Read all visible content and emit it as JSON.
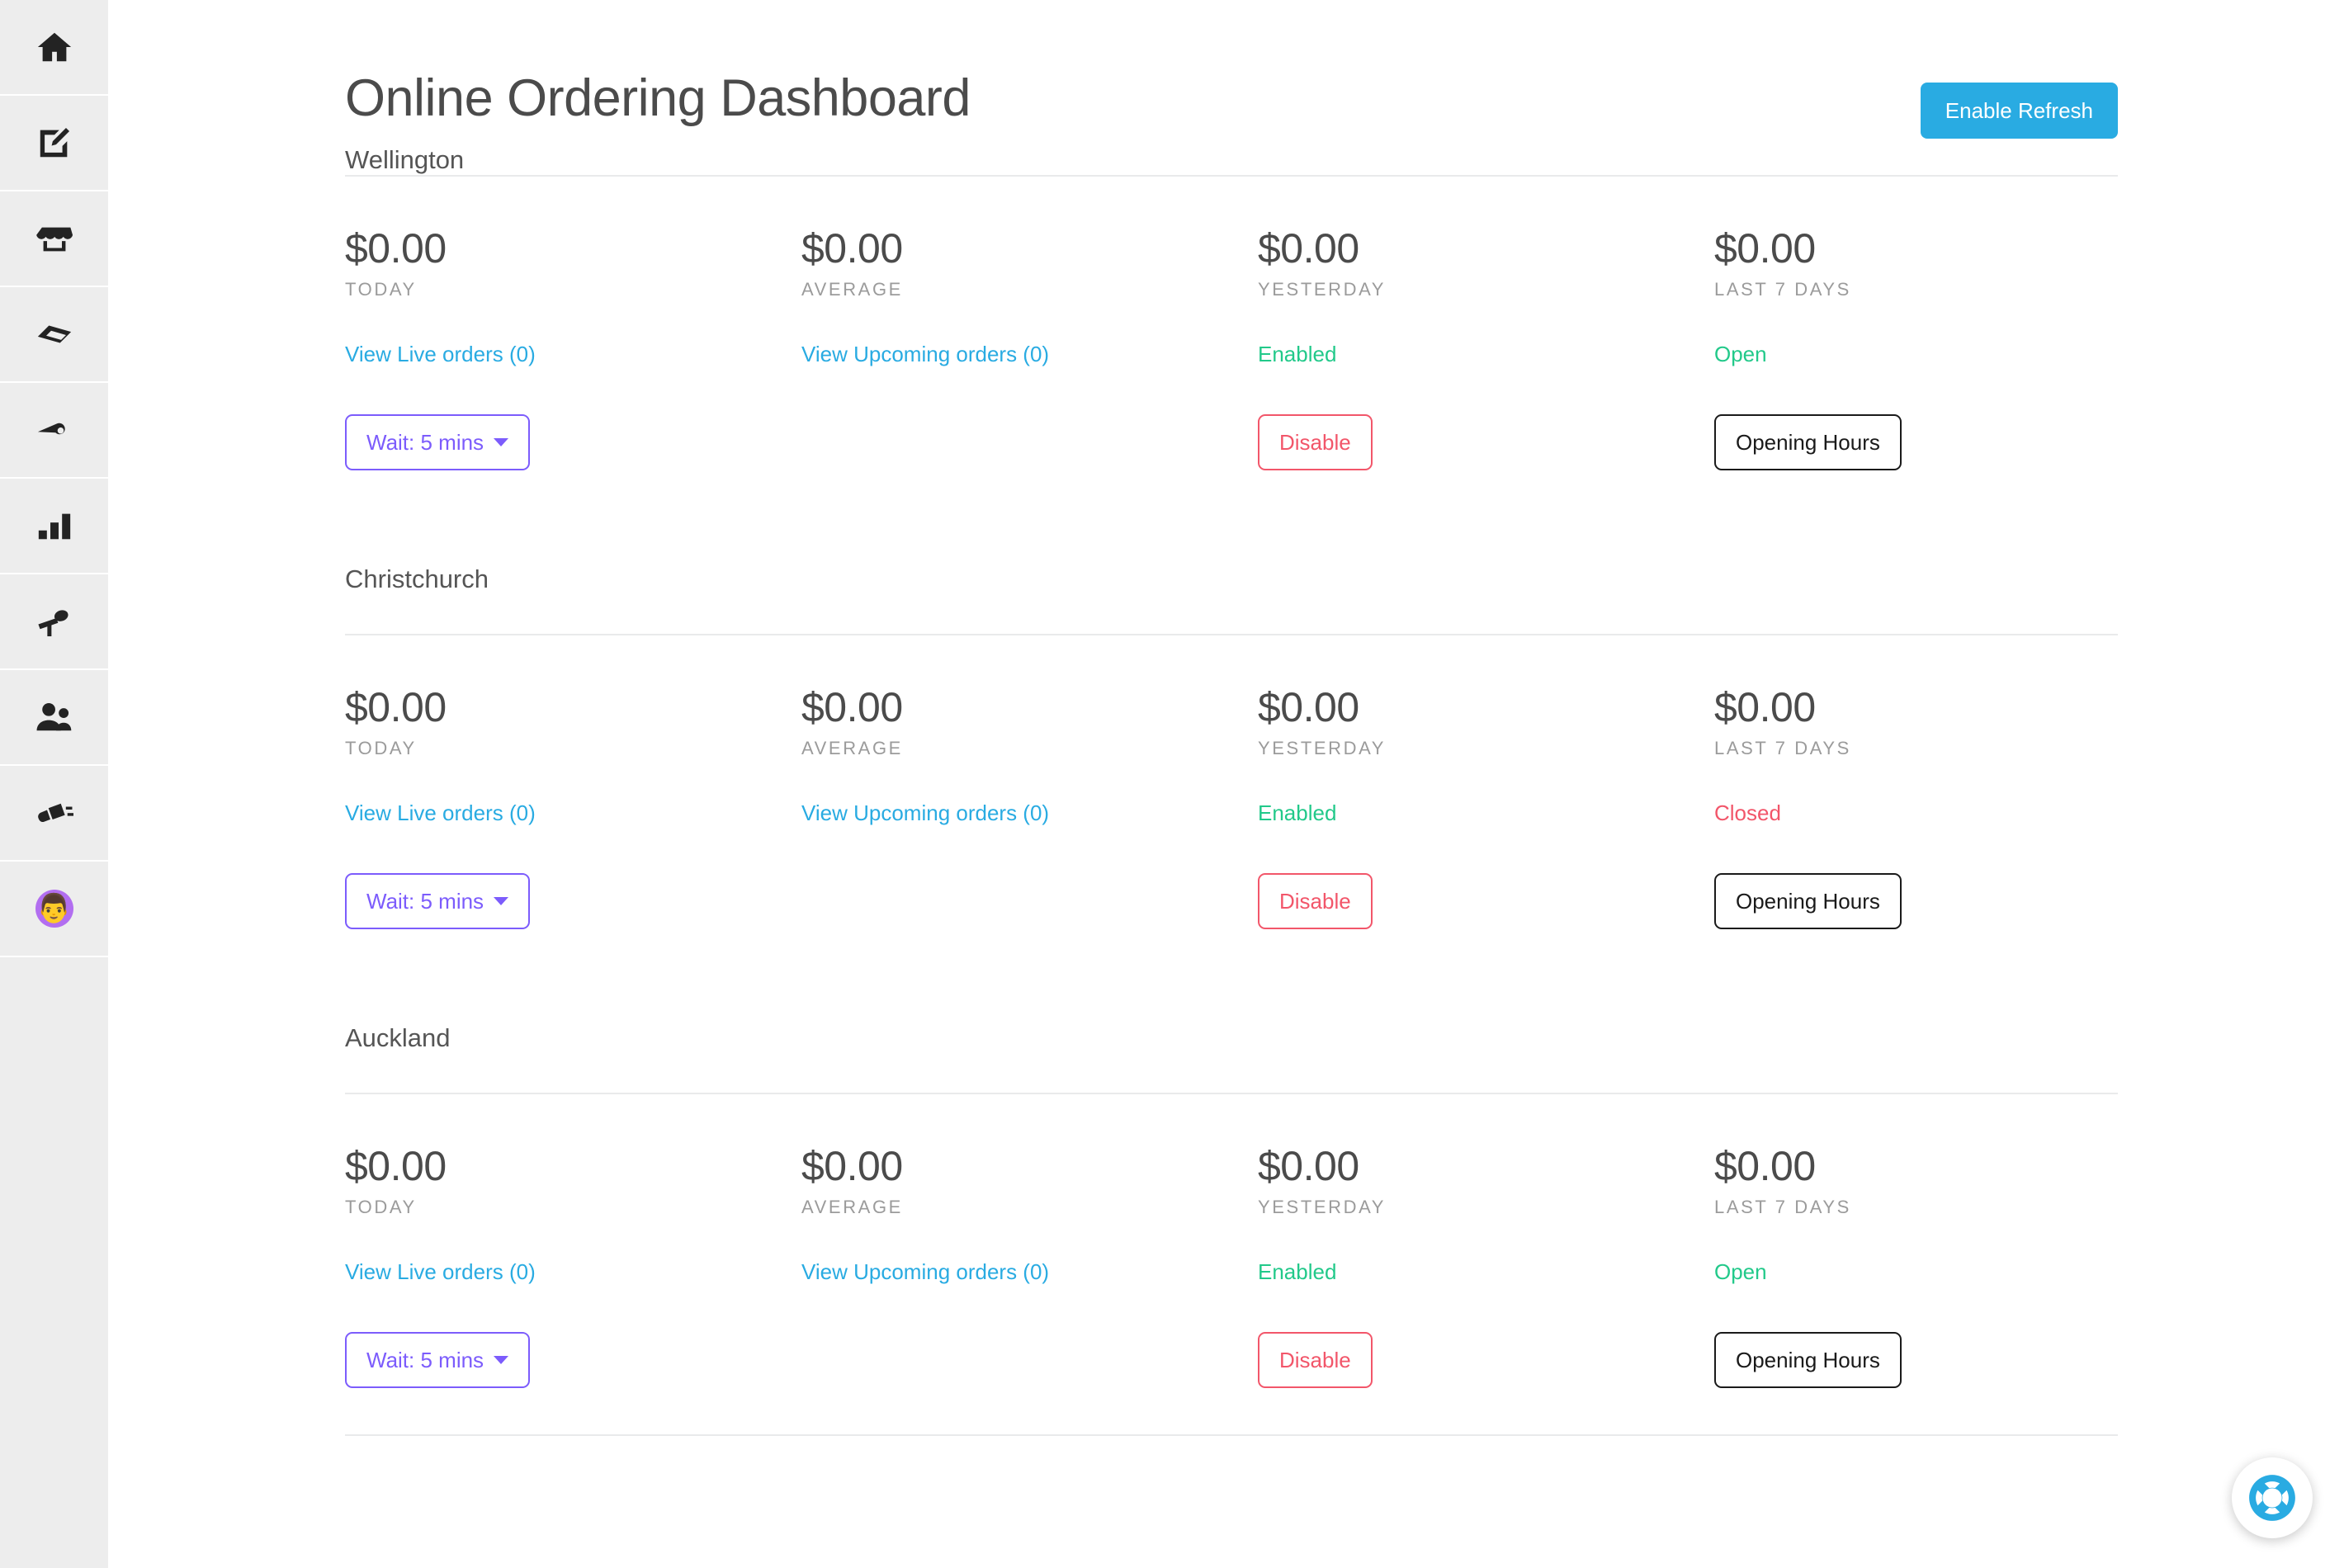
{
  "sidebar": {
    "items": [
      {
        "icon": "home-icon",
        "name": "sidebar-item-home"
      },
      {
        "icon": "edit-square-icon",
        "name": "sidebar-item-edit"
      },
      {
        "icon": "store-icon",
        "name": "sidebar-item-store"
      },
      {
        "icon": "ticket-icon",
        "name": "sidebar-item-tickets"
      },
      {
        "icon": "megaphone-icon",
        "name": "sidebar-item-promotions"
      },
      {
        "icon": "bar-chart-icon",
        "name": "sidebar-item-reports"
      },
      {
        "icon": "microphone-icon",
        "name": "sidebar-item-feedback"
      },
      {
        "icon": "users-icon",
        "name": "sidebar-item-customers"
      },
      {
        "icon": "plug-icon",
        "name": "sidebar-item-integrations"
      }
    ],
    "avatar": {
      "name": "avatar",
      "glyph": "👨"
    }
  },
  "header": {
    "title": "Online Ordering Dashboard",
    "subtitle": "Wellington",
    "refresh_label": "Enable Refresh"
  },
  "colors": {
    "accent_blue": "#29ABE2",
    "link_blue": "#29ABE2",
    "status_open_green": "#22c98a",
    "status_closed_red": "#f2566a",
    "wait_purple": "#7c5cfc",
    "disable_red": "#f2566a",
    "sidebar_bg": "#ededed",
    "title_grey": "#4b4b4b",
    "label_grey": "#9b9b9b"
  },
  "stat_labels": {
    "today": "TODAY",
    "average": "AVERAGE",
    "yesterday": "YESTERDAY",
    "last7": "LAST 7 DAYS"
  },
  "stores": [
    {
      "name": "Wellington",
      "show_name_heading": false,
      "today_value": "$0.00",
      "today_label": "TODAY",
      "average_value": "$0.00",
      "average_label": "AVERAGE",
      "yesterday_value": "$0.00",
      "yesterday_label": "YESTERDAY",
      "last7_value": "$0.00",
      "last7_label": "LAST 7 DAYS",
      "live_orders_link": "View Live orders (0)",
      "upcoming_orders_link": "View Upcoming orders (0)",
      "ordering_status": "Enabled",
      "ordering_status_kind": "open",
      "store_status": "Open",
      "store_status_kind": "open",
      "wait_button": "Wait: 5 mins",
      "disable_button": "Disable",
      "opening_hours_button": "Opening Hours"
    },
    {
      "name": "Christchurch",
      "show_name_heading": true,
      "today_value": "$0.00",
      "today_label": "TODAY",
      "average_value": "$0.00",
      "average_label": "AVERAGE",
      "yesterday_value": "$0.00",
      "yesterday_label": "YESTERDAY",
      "last7_value": "$0.00",
      "last7_label": "LAST 7 DAYS",
      "live_orders_link": "View Live orders (0)",
      "upcoming_orders_link": "View Upcoming orders (0)",
      "ordering_status": "Enabled",
      "ordering_status_kind": "open",
      "store_status": "Closed",
      "store_status_kind": "closed",
      "wait_button": "Wait: 5 mins",
      "disable_button": "Disable",
      "opening_hours_button": "Opening Hours"
    },
    {
      "name": "Auckland",
      "show_name_heading": true,
      "today_value": "$0.00",
      "today_label": "TODAY",
      "average_value": "$0.00",
      "average_label": "AVERAGE",
      "yesterday_value": "$0.00",
      "yesterday_label": "YESTERDAY",
      "last7_value": "$0.00",
      "last7_label": "LAST 7 DAYS",
      "live_orders_link": "View Live orders (0)",
      "upcoming_orders_link": "View Upcoming orders (0)",
      "ordering_status": "Enabled",
      "ordering_status_kind": "open",
      "store_status": "Open",
      "store_status_kind": "open",
      "wait_button": "Wait: 5 mins",
      "disable_button": "Disable",
      "opening_hours_button": "Opening Hours"
    }
  ],
  "help_widget": {
    "icon": "lifebuoy-icon"
  }
}
